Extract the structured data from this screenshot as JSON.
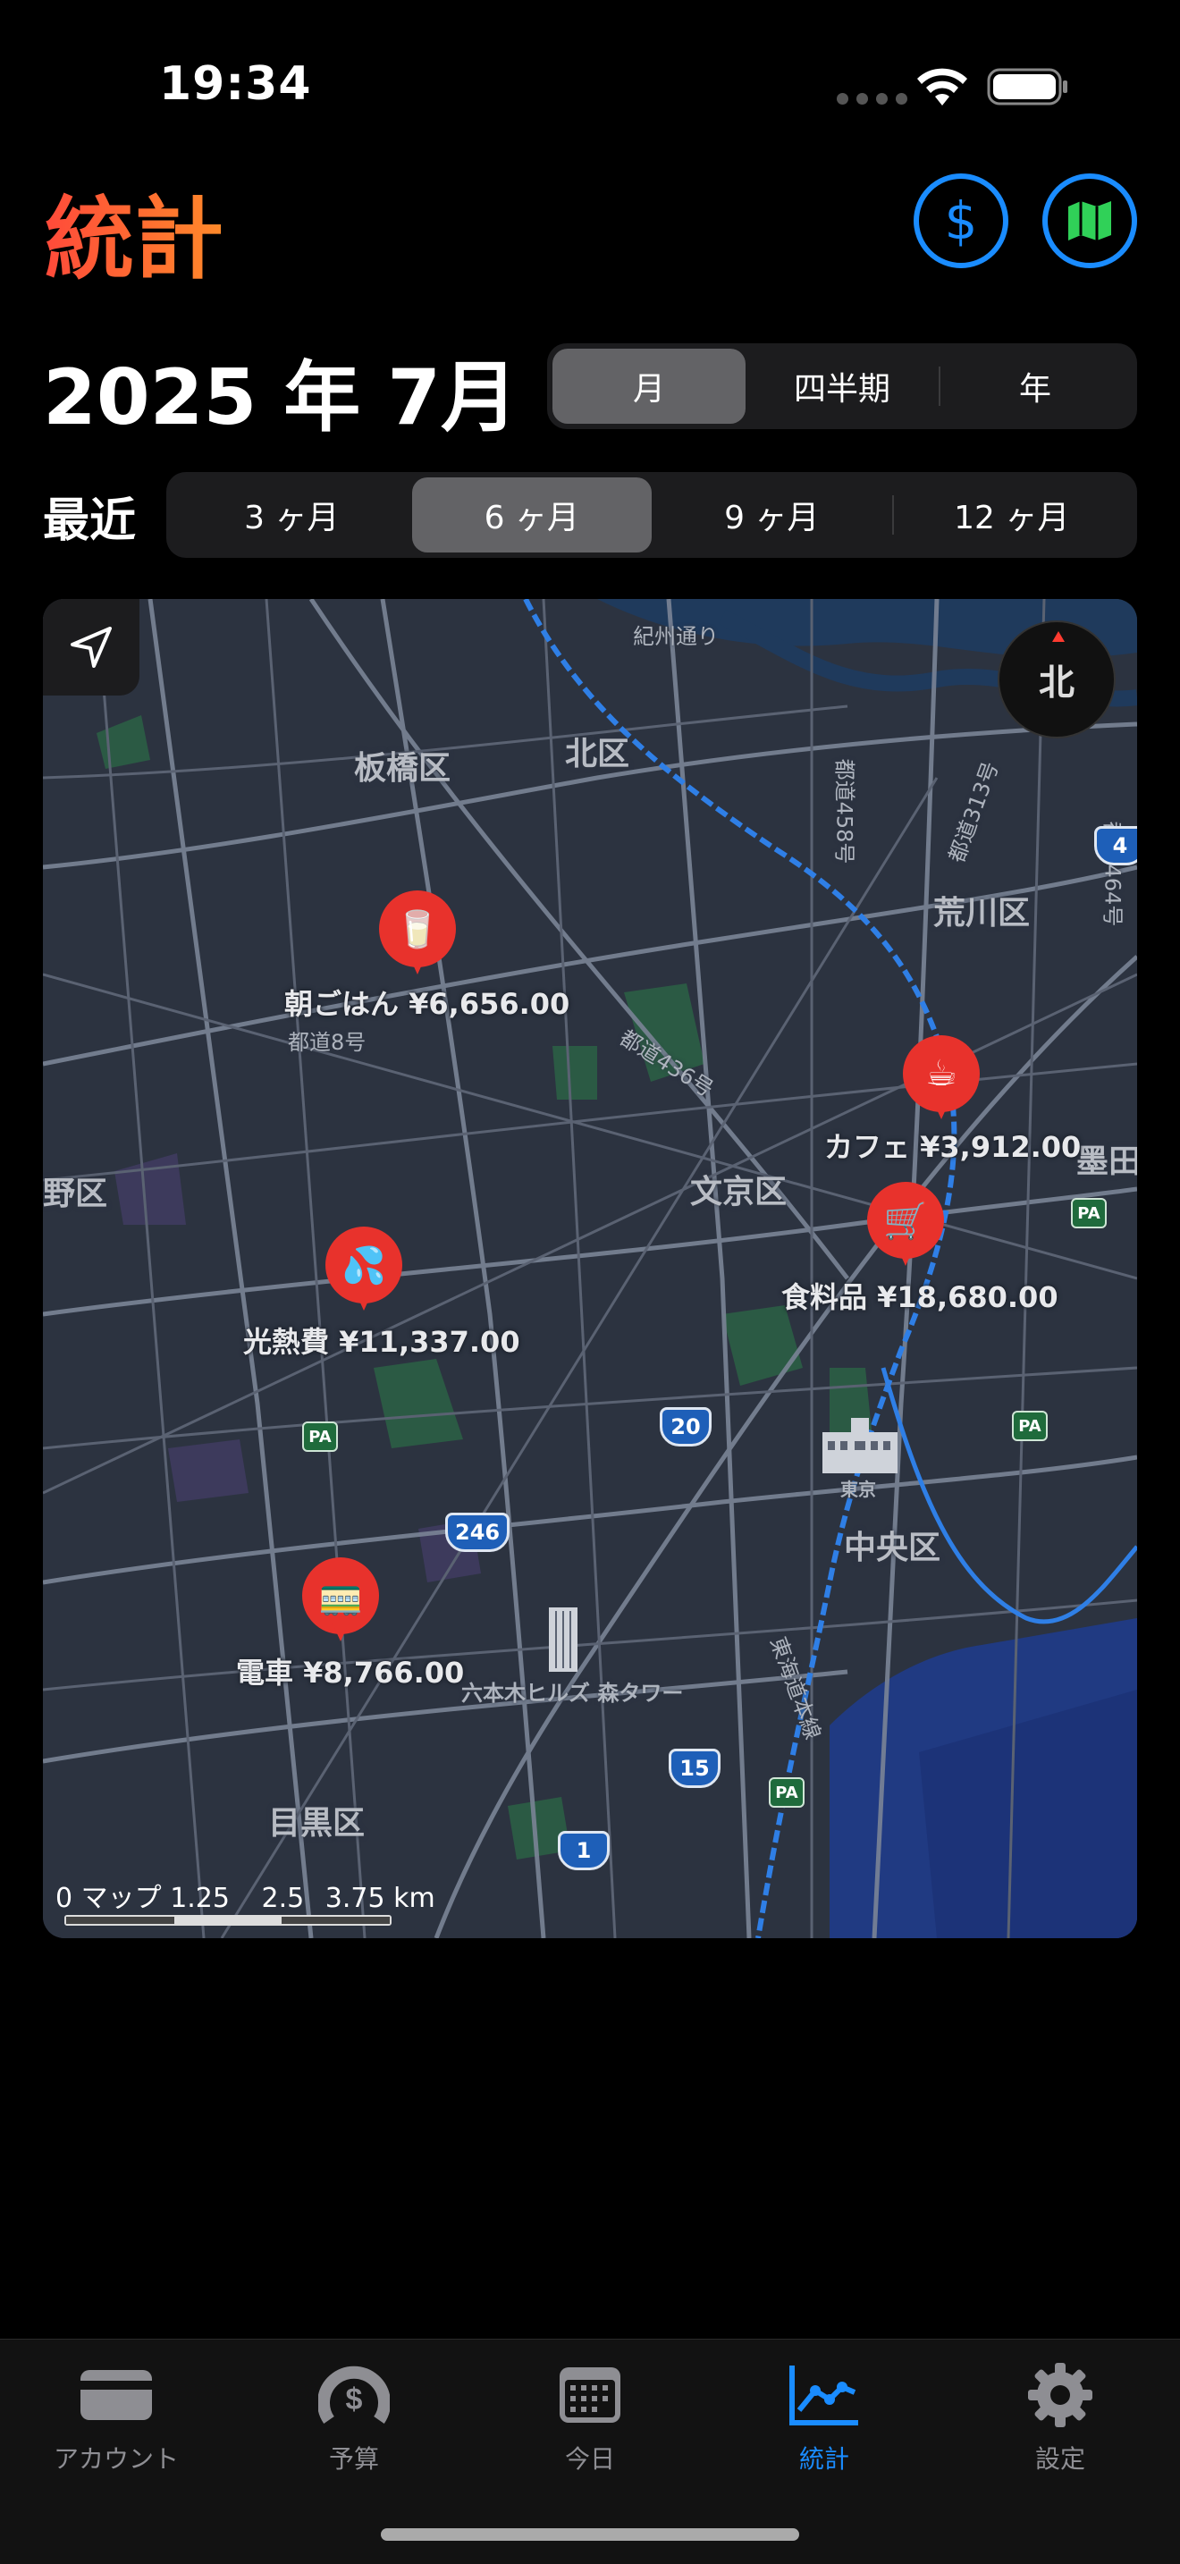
{
  "status": {
    "time": "19:34"
  },
  "header": {
    "title": "統計",
    "dollar_icon": "dollar-circle-icon",
    "map_icon": "map-icon"
  },
  "period": {
    "title": "2025 年 7月"
  },
  "period_segment": {
    "options": [
      "月",
      "四半期",
      "年"
    ],
    "selected": 0
  },
  "recent": {
    "label": "最近",
    "options": [
      "3 ヶ月",
      "6 ヶ月",
      "9 ヶ月",
      "12 ヶ月"
    ],
    "selected": 1
  },
  "map": {
    "compass": "北",
    "areas": [
      "板橋区",
      "北区",
      "荒川区",
      "文京区",
      "野区",
      "墨田",
      "中央区",
      "目黒区"
    ],
    "roads": [
      "紀州通り",
      "都道436号",
      "都道8号",
      "都道458号",
      "都道313号",
      "都道464号",
      "東海道本線",
      "東京",
      "六本木ヒルズ 森タワー"
    ],
    "pins": [
      {
        "label": "朝ごはん ¥6,656.00",
        "icon": "cup-icon"
      },
      {
        "label": "カフェ ¥3,912.00",
        "icon": "coffee-icon"
      },
      {
        "label": "食料品 ¥18,680.00",
        "icon": "cart-icon"
      },
      {
        "label": "光熱費 ¥11,337.00",
        "icon": "droplets-icon"
      },
      {
        "label": "電車 ¥8,766.00",
        "icon": "train-icon"
      }
    ],
    "shields": [
      "4",
      "20",
      "246",
      "15",
      "1"
    ],
    "pa": "PA",
    "attribution": "マップ",
    "scale": [
      "0",
      "1.25",
      "2.5",
      "3.75 km"
    ]
  },
  "tabs": [
    {
      "label": "アカウント",
      "icon": "card-icon"
    },
    {
      "label": "予算",
      "icon": "budget-gauge-icon"
    },
    {
      "label": "今日",
      "icon": "calendar-icon"
    },
    {
      "label": "統計",
      "icon": "chart-line-icon"
    },
    {
      "label": "設定",
      "icon": "gear-icon"
    }
  ],
  "colors": {
    "accent": "#1a8cff",
    "title_gradient_start": "#ff4a3a",
    "title_gradient_end": "#ff8a2a",
    "pin": "#e8322c"
  }
}
